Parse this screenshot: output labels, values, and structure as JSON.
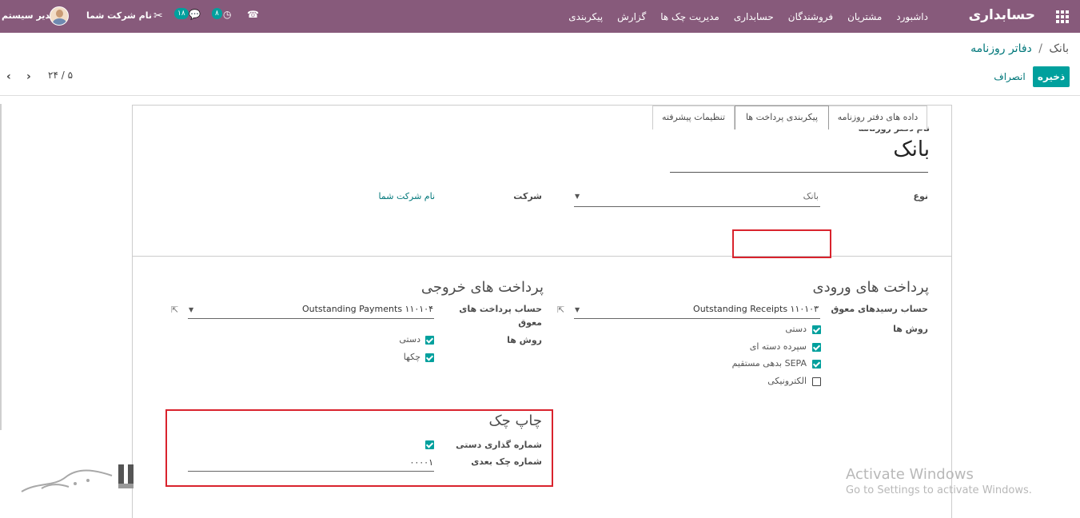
{
  "navbar": {
    "brand": "حسابداری",
    "menu": [
      "داشبورد",
      "مشتریان",
      "فروشندگان",
      "حسابداری",
      "مدیریت چک ها",
      "گزارش",
      "پیکربندی"
    ],
    "user": "مدیر سیستم",
    "company": "نام شرکت شما",
    "messages_count": "۱۸",
    "activities_count": "۸",
    "icons": [
      "apps-icon",
      "avatar",
      "debug-icon",
      "messages-icon",
      "activity-clock-icon",
      "phone-icon"
    ],
    "color": "#875a7b"
  },
  "breadcrumb": {
    "parent": "دفاتر روزنامه",
    "separator": "/",
    "current": "بانک"
  },
  "actions": {
    "save": "ذخیره",
    "discard": "انصراف"
  },
  "pager": {
    "value": "۲۴ / ۵"
  },
  "form": {
    "journal_name_label": "نام دفتر روزنامه",
    "journal_name": "بانک",
    "type_label": "نوع",
    "type_value": "بانک",
    "company_label": "شرکت",
    "company_value": "نام شرکت شما",
    "tabs": [
      "داده های دفتر روزنامه",
      "پیکربندی پرداخت ها",
      "تنظیمات پیشرفته"
    ],
    "active_tab": "پیکربندی پرداخت ها",
    "incoming": {
      "title": "پرداخت های ورودی",
      "account_label": "حساب رسیدهای معوق",
      "account_value": "Outstanding Receipts ۱۱۰۱۰۳",
      "methods_label": "روش ها",
      "methods": [
        {
          "label": "دستی",
          "checked": true
        },
        {
          "label": "سپرده دسته ای",
          "checked": true
        },
        {
          "label": "بدهی مستقیم SEPA",
          "checked": true
        },
        {
          "label": "الکترونیکی",
          "checked": false
        }
      ]
    },
    "outgoing": {
      "title": "پرداخت های خروجی",
      "account_label_line1": "حساب پرداخت های",
      "account_label_line2": "معوق",
      "account_value": "Outstanding Payments ۱۱۰۱۰۴",
      "methods_label": "روش ها",
      "methods": [
        {
          "label": "دستی",
          "checked": true
        },
        {
          "label": "چکها",
          "checked": true
        }
      ]
    },
    "check_printing": {
      "title": "چاپ چک",
      "manual_numbering_label": "شماره گذاری دستی",
      "manual_numbering": true,
      "next_number_label": "شماره چک بعدی",
      "next_number": "۰۰۰۰۱"
    },
    "highlight_color": "#d9232d",
    "accent": "#00a09d"
  },
  "watermark": {
    "title": "Activate Windows",
    "subtitle": "Go to Settings to activate Windows."
  }
}
